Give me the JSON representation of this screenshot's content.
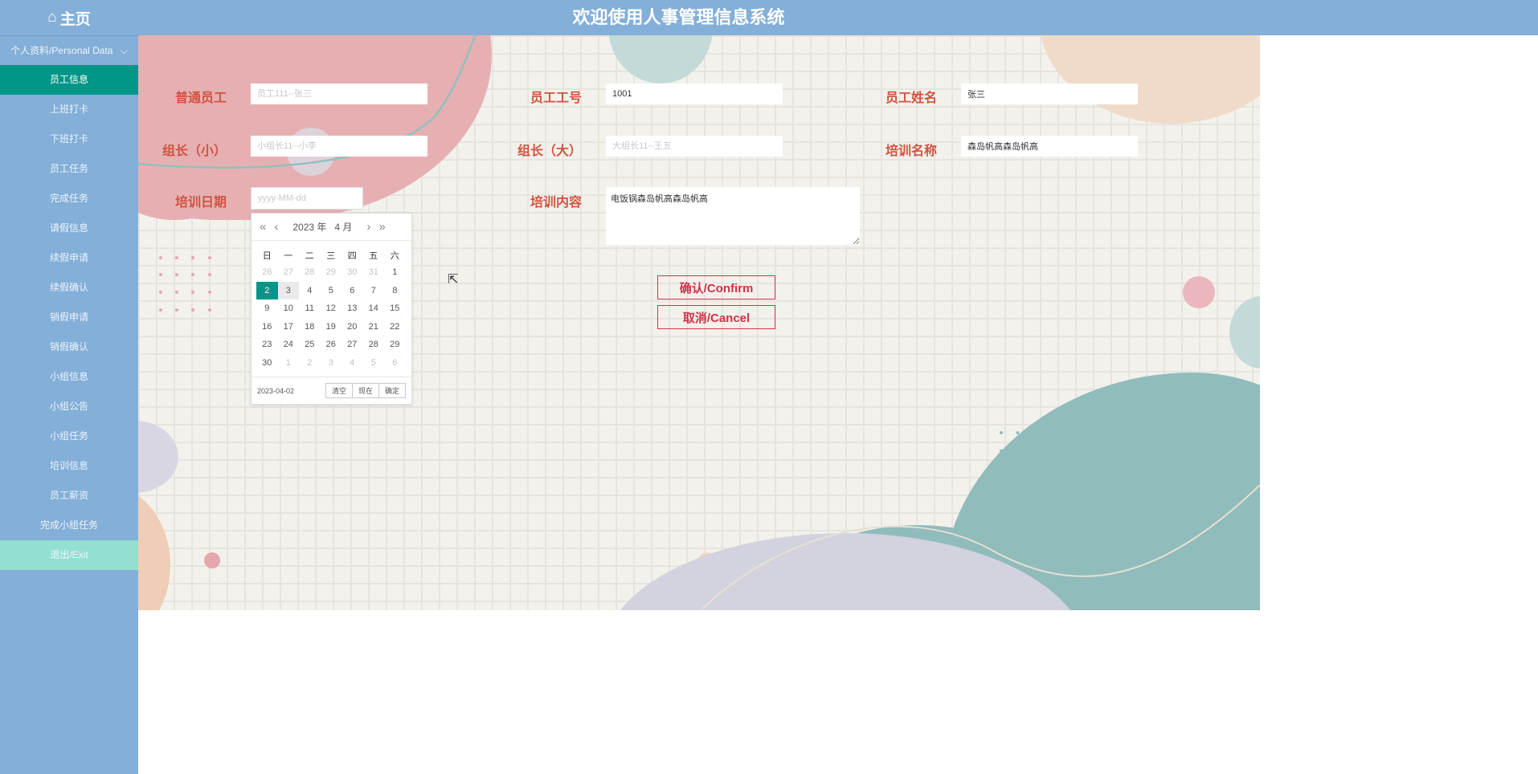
{
  "header": {
    "home_label": "主页",
    "title": "欢迎使用人事管理信息系统"
  },
  "sidebar": {
    "group": "个人资料/Personal Data",
    "items": [
      "员工信息",
      "上班打卡",
      "下班打卡",
      "员工任务",
      "完成任务",
      "请假信息",
      "续假申请",
      "续假确认",
      "销假申请",
      "销假确认",
      "小组信息",
      "小组公告",
      "小组任务",
      "培训信息",
      "员工薪资",
      "完成小组任务"
    ],
    "exit": "退出/Exit"
  },
  "form": {
    "employee": {
      "label": "普通员工",
      "placeholder": "员工111--张三"
    },
    "emp_no": {
      "label": "员工工号",
      "value": "1001"
    },
    "emp_name": {
      "label": "员工姓名",
      "value": "张三"
    },
    "leader_small": {
      "label": "组长（小）",
      "placeholder": "小组长11--小李"
    },
    "leader_big": {
      "label": "组长（大）",
      "placeholder": "大组长11--王五"
    },
    "training_name": {
      "label": "培训名称",
      "value": "森岛帆高森岛帆高"
    },
    "training_date": {
      "label": "培训日期",
      "placeholder": "yyyy-MM-dd"
    },
    "training_content": {
      "label": "培训内容",
      "value": "电饭锅森岛帆高森岛帆高"
    },
    "confirm": "确认/Confirm",
    "cancel": "取消/Cancel"
  },
  "calendar": {
    "year": "2023 年",
    "month": "4 月",
    "weekdays": [
      "日",
      "一",
      "二",
      "三",
      "四",
      "五",
      "六"
    ],
    "weeks": [
      [
        "26",
        "27",
        "28",
        "29",
        "30",
        "31",
        "1"
      ],
      [
        "2",
        "3",
        "4",
        "5",
        "6",
        "7",
        "8"
      ],
      [
        "9",
        "10",
        "11",
        "12",
        "13",
        "14",
        "15"
      ],
      [
        "16",
        "17",
        "18",
        "19",
        "20",
        "21",
        "22"
      ],
      [
        "23",
        "24",
        "25",
        "26",
        "27",
        "28",
        "29"
      ],
      [
        "30",
        "1",
        "2",
        "3",
        "4",
        "5",
        "6"
      ]
    ],
    "selected": "2023-04-02",
    "clear": "清空",
    "now": "现在",
    "ok": "确定"
  },
  "colors": {
    "accent": "#009688",
    "label": "#d0533f",
    "header": "#83afd8"
  }
}
